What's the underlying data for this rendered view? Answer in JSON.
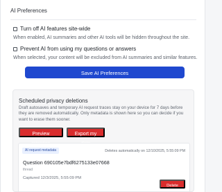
{
  "ai_preferences": {
    "title": "AI Preferences",
    "turn_off": {
      "label": "Turn off AI features site-wide",
      "help": "When enabled, AI summaries and other AI tools will be hidden throughout the site."
    },
    "prevent_use": {
      "label": "Prevent AI from using my questions or answers",
      "help": "When selected, your content will be excluded from AI summaries and similar features."
    },
    "save_button": "Save AI Preferences"
  },
  "privacy": {
    "title": "Scheduled privacy deletions",
    "description": "Draft autosaves and temporary AI request traces stay on your device for 7 days before they are removed automatically. Only metadata is shown here so you can decide if you want to erase them sooner.",
    "preview_button": "Preview retention",
    "export_button": "Export my data",
    "item": {
      "badge": "AI request metadata",
      "auto_delete": "Deletes automatically on 12/10/2025, 5:55:09 PM",
      "question": "Question 690105e7bdf6275133e07668",
      "thread": "thread",
      "captured": "Captured 12/3/2025, 5:55:09 PM",
      "delete_button": "Delete now"
    }
  },
  "colors": {
    "primary": "#1f48cf",
    "danger": "#d92d2d",
    "badge": "#e9f0ff"
  }
}
